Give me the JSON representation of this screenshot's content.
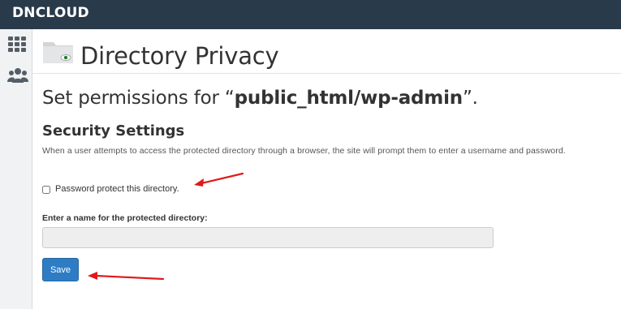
{
  "brand": {
    "name": "DNCLOUD"
  },
  "sidebar": {
    "items": [
      {
        "icon": "grid-icon"
      },
      {
        "icon": "users-icon"
      }
    ]
  },
  "page": {
    "icon": "folder-eye-icon",
    "title": "Directory Privacy",
    "subtitle_prefix": "Set permissions for “",
    "directory": "public_html/wp-admin",
    "subtitle_suffix": "”."
  },
  "security": {
    "title": "Security Settings",
    "help": "When a user attempts to access the protected directory through a browser, the site will prompt them to enter a username and password.",
    "checkbox_label": "Password protect this directory.",
    "checkbox_checked": false,
    "name_label": "Enter a name for the protected directory:",
    "name_value": "",
    "save_label": "Save"
  },
  "annotations": {
    "arrow_color": "#e0191b"
  }
}
